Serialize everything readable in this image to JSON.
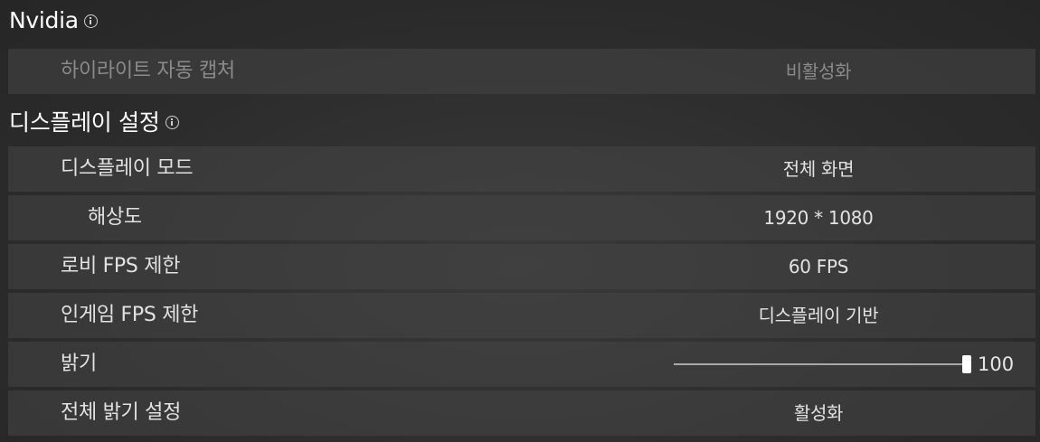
{
  "sections": {
    "nvidia": {
      "title": "Nvidia",
      "rows": {
        "highlight": {
          "label": "하이라이트 자동 캡처",
          "value": "비활성화"
        }
      }
    },
    "display": {
      "title": "디스플레이 설정",
      "rows": {
        "display_mode": {
          "label": "디스플레이 모드",
          "value": "전체 화면"
        },
        "resolution": {
          "label": "해상도",
          "value": "1920 * 1080"
        },
        "lobby_fps": {
          "label": "로비 FPS 제한",
          "value": "60 FPS"
        },
        "ingame_fps": {
          "label": "인게임 FPS 제한",
          "value": "디스플레이 기반"
        },
        "brightness": {
          "label": "밝기",
          "value": "100",
          "level_fraction": 1.0
        },
        "global_brightness": {
          "label": "전체 밝기 설정",
          "value": "활성화"
        }
      }
    }
  },
  "icons": {
    "info": "info-icon"
  },
  "colors": {
    "background": "#2c2c2c",
    "row": "#464646",
    "text": "#e2e2e2",
    "disabled_text": "#8a8a8a"
  }
}
